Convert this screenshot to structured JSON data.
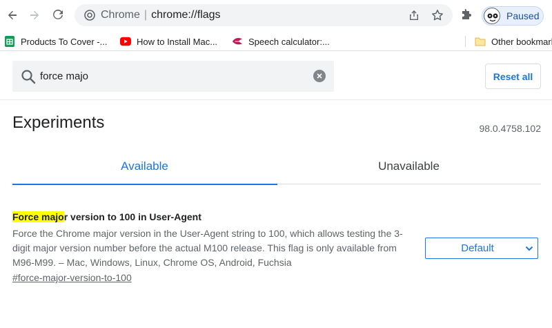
{
  "browser": {
    "omnibox_site": "Chrome",
    "omnibox_url": "chrome://flags",
    "profile_label": "Paused"
  },
  "bookmarks": [
    {
      "label": "Products To Cover -...",
      "icon": "sheets-icon"
    },
    {
      "label": "How to Install Mac...",
      "icon": "youtube-icon"
    },
    {
      "label": "Speech calculator:...",
      "icon": "speech-icon"
    },
    {
      "label": "Other bookmarks",
      "icon": "folder-icon"
    }
  ],
  "flags": {
    "search_value": "force majo",
    "reset_label": "Reset all",
    "title": "Experiments",
    "version": "98.0.4758.102",
    "tabs": [
      {
        "label": "Available"
      },
      {
        "label": "Unavailable"
      }
    ],
    "experiment": {
      "title_highlight": "Force majo",
      "title_rest": "r version to 100 in User-Agent",
      "description": "Force the Chrome major version in the User-Agent string to 100, which allows testing the 3-digit major version number before the actual M100 release. This flag is only available from M96-M99. – Mac, Windows, Linux, Chrome OS, Android, Fuchsia",
      "link": "#force-major-version-to-100",
      "select_value": "Default"
    }
  },
  "colors": {
    "accent": "#1a73e8",
    "highlight": "#ffff00"
  }
}
